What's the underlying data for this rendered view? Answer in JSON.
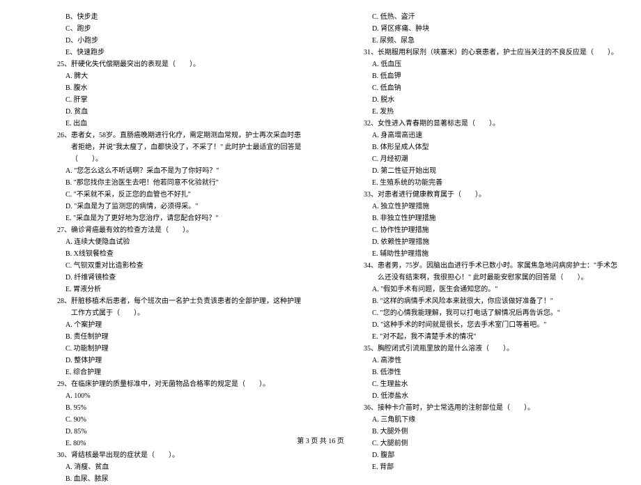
{
  "left": {
    "pre_opts": [
      "B、快步走",
      "C、跑步",
      "D、小跑步",
      "E、快速跑步"
    ],
    "q25": {
      "stem": "25、肝硬化失代偿期最突出的表现是（　　）。",
      "opts": [
        "A. 脾大",
        "B. 腹水",
        "C. 肝掌",
        "D. 贫血",
        "E. 出血"
      ]
    },
    "q26": {
      "stem": "26、患者女，58岁。直肠癌晚期进行化疗，需定期测血常规，护士再次采血时患者拒绝，并说\"我太瘦了，血都快没了，不采了！\" 此时护士最适宜的回答是（　　）。",
      "opts": [
        "A. \"您怎么这么不听话啊？采血不是为了你好吗？\"",
        "B. \"那您找你主治医生去吧！他若同意不化验就行\"",
        "C. \"不采就不采，反正您的血管也不好扎\"",
        "D. \"采血是为了监测您的病情，必须得采。\"",
        "E. \"采血是为了更好地为您治疗，请您配合好吗？\""
      ]
    },
    "q27": {
      "stem": "27、确诊肾癌最有效的检查方法是（　　）。",
      "opts": [
        "A. 连续大便隐血试验",
        "B. X线钡餐检查",
        "C. 气钡双重对比造影检查",
        "D. 纤维肾镜检查",
        "E. 胃液分析"
      ]
    },
    "q28": {
      "stem": "28、肝脏移植术后患者，每个班次由一名护士负责该患者的全部护理，这种护理工作方式属于（　　）。",
      "opts": [
        "A. 个案护理",
        "B. 责任制护理",
        "C. 功能制护理",
        "D. 整体护理",
        "E. 综合护理"
      ]
    },
    "q29": {
      "stem": "29、在临床护理的质量标准中，对无菌物品合格率的规定是（　　）。",
      "opts": [
        "A. 100%",
        "B. 95%",
        "C. 90%",
        "D. 85%",
        "E. 80%"
      ]
    },
    "q30": {
      "stem": "30、肾结核最早出现的症状是（　　）。",
      "opts": [
        "A. 消瘦、贫血",
        "B. 血尿、脓尿"
      ]
    }
  },
  "right": {
    "pre_opts": [
      "C. 低热、盗汗",
      "D. 肾区疼痛、肿块",
      "E. 尿频、尿急"
    ],
    "q31": {
      "stem": "31、长期服用利尿剂（呋塞米）的心衰患者，护士应当关注的不良反应是（　　）。",
      "opts": [
        "A. 低血压",
        "B. 低血钾",
        "C. 低血钠",
        "D. 脱水",
        "E. 发热"
      ]
    },
    "q32": {
      "stem": "32、女性进入青春期的显著标志是（　　）。",
      "opts": [
        "A. 身高增高迅速",
        "B. 体形呈成人体型",
        "C. 月经初潮",
        "D. 第二性征开始出现",
        "E. 生殖系统的功能完善"
      ]
    },
    "q33": {
      "stem": "33、对患者进行健康教育属于（　　）。",
      "opts": [
        "A. 独立性护理措施",
        "B. 非独立性护理措施",
        "C. 协作性护理措施",
        "D. 依赖性护理措施",
        "E. 辅助性护理措施"
      ]
    },
    "q34": {
      "stem": "34、患者男，75岁。因脑出血进行手术已数小时。家属焦急地问病房护士：\"手术怎么还没有结束啊，我很担心！\" 此时最能安慰家属的回答是（　　）。",
      "opts": [
        "A. \"假如手术有问题，医生会通知您的。\"",
        "B. \"这样的病情手术风险本来就很大，你应该做好准备了！\"",
        "C. \"您的心情我能理解，我可以打电话了解情况后再告诉您。\"",
        "D. \"这种手术的时间就是很长，您去手术室门口等着吧。\"",
        "E. \"对不起，我不清楚手术的情况\""
      ]
    },
    "q35": {
      "stem": "35、胸腔闭式引流瓶里放的是什么溶液（　　）。",
      "opts": [
        "A. 高渗性",
        "B. 低渗性",
        "C. 生理盐水",
        "D. 低渗盐水"
      ]
    },
    "q36": {
      "stem": "36、接种卡介苗时，护士常选用的注射部位是（　　）。",
      "opts": [
        "A. 三角肌下缘",
        "B. 大腿外侧",
        "C. 大腿前侧",
        "D. 腹部",
        "E. 背部"
      ]
    }
  },
  "footer": "第 3 页 共 16 页"
}
